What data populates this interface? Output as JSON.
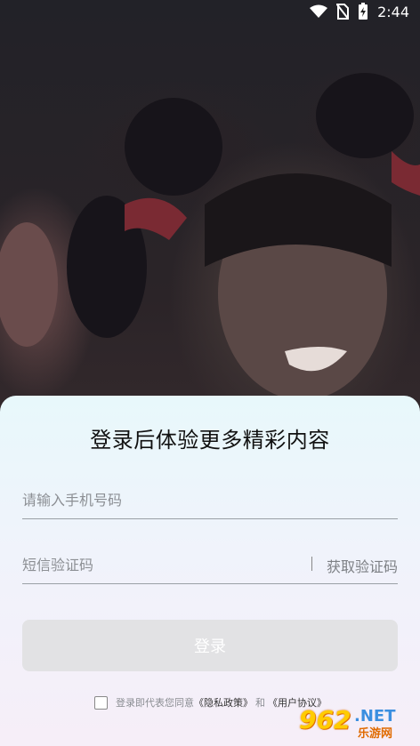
{
  "status_bar": {
    "time": "2:44"
  },
  "login": {
    "title": "登录后体验更多精彩内容",
    "phone_placeholder": "请输入手机号码",
    "code_placeholder": "短信验证码",
    "get_code_label": "获取验证码",
    "login_button": "登录",
    "agreement": {
      "prefix": "登录即代表您同意",
      "privacy": "《隐私政策》",
      "and": "和",
      "terms": "《用户协议》",
      "checked": false
    }
  },
  "watermark": {
    "number": "962",
    "domain": ".NET",
    "name": "乐游网"
  },
  "colors": {
    "sheet_top": "#e8f8fb",
    "sheet_bottom": "#f6eef8",
    "button": "#e2e2e4"
  }
}
